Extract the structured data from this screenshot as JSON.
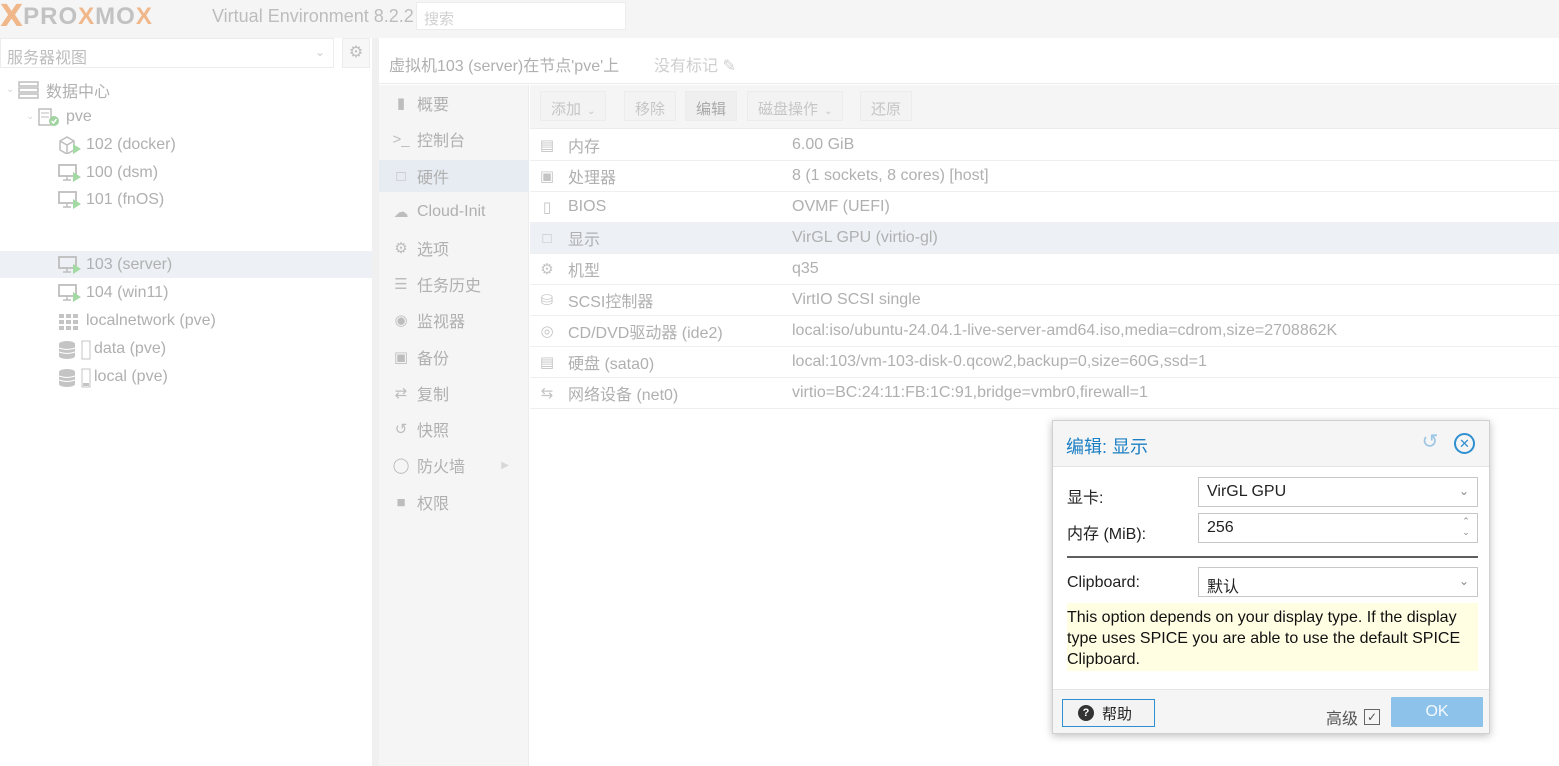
{
  "header": {
    "logo_x1": "X",
    "logo_text1": "PRO",
    "logo_x2": "X",
    "logo_mid": "MO",
    "logo_x3": "X",
    "version": "Virtual Environment 8.2.2",
    "search_placeholder": "搜索"
  },
  "left": {
    "view_selector": "服务器视图",
    "tree": [
      {
        "label": "数据中心",
        "icon": "datacenter-icon"
      },
      {
        "label": "pve",
        "icon": "node-icon"
      },
      {
        "label": "102 (docker)",
        "icon": "container-running-icon"
      },
      {
        "label": "100 (dsm)",
        "icon": "vm-running-icon"
      },
      {
        "label": "101 (fnOS)",
        "icon": "vm-running-icon"
      },
      {
        "label": "103 (server)",
        "icon": "vm-running-icon"
      },
      {
        "label": "104 (win11)",
        "icon": "vm-running-icon"
      },
      {
        "label": "localnetwork (pve)",
        "icon": "sdn-grid-icon"
      },
      {
        "label": "data (pve)",
        "icon": "storage-icon"
      },
      {
        "label": "local (pve)",
        "icon": "storage-icon"
      }
    ]
  },
  "right": {
    "title": "虚拟机103 (server)在节点'pve'上",
    "tags": "没有标记",
    "nav": [
      {
        "label": "概要",
        "icon": "book-icon"
      },
      {
        "label": "控制台",
        "icon": "terminal-icon"
      },
      {
        "label": "硬件",
        "icon": "monitor-icon"
      },
      {
        "label": "Cloud-Init",
        "icon": "cloud-icon"
      },
      {
        "label": "选项",
        "icon": "gear-icon"
      },
      {
        "label": "任务历史",
        "icon": "list-icon"
      },
      {
        "label": "监视器",
        "icon": "eye-icon"
      },
      {
        "label": "备份",
        "icon": "floppy-icon"
      },
      {
        "label": "复制",
        "icon": "retweet-icon"
      },
      {
        "label": "快照",
        "icon": "history-icon"
      },
      {
        "label": "防火墙",
        "icon": "shield-icon"
      },
      {
        "label": "权限",
        "icon": "unlock-icon"
      }
    ],
    "toolbar": {
      "add": "添加",
      "remove": "移除",
      "edit": "编辑",
      "disk_action": "磁盘操作",
      "revert": "还原"
    },
    "hardware": [
      {
        "name": "内存",
        "value": "6.00 GiB",
        "icon": "memory-icon"
      },
      {
        "name": "处理器",
        "value": "8 (1 sockets, 8 cores) [host]",
        "icon": "cpu-icon"
      },
      {
        "name": "BIOS",
        "value": "OVMF (UEFI)",
        "icon": "microchip-icon"
      },
      {
        "name": "显示",
        "value": "VirGL GPU (virtio-gl)",
        "icon": "desktop-icon"
      },
      {
        "name": "机型",
        "value": "q35",
        "icon": "cogs-icon"
      },
      {
        "name": "SCSI控制器",
        "value": "VirtIO SCSI single",
        "icon": "database-icon"
      },
      {
        "name": "CD/DVD驱动器 (ide2)",
        "value": "local:iso/ubuntu-24.04.1-live-server-amd64.iso,media=cdrom,size=2708862K",
        "icon": "cdrom-icon"
      },
      {
        "name": "硬盘 (sata0)",
        "value": "local:103/vm-103-disk-0.qcow2,backup=0,size=60G,ssd=1",
        "icon": "hdd-icon"
      },
      {
        "name": "网络设备 (net0)",
        "value": "virtio=BC:24:11:FB:1C:91,bridge=vmbr0,firewall=1",
        "icon": "exchange-icon"
      }
    ]
  },
  "dialog": {
    "title": "编辑: 显示",
    "gpu_label": "显卡:",
    "gpu_value": "VirGL GPU",
    "mem_label": "内存 (MiB):",
    "mem_value": "256",
    "clipboard_label": "Clipboard:",
    "clipboard_value": "默认",
    "info": "This option depends on your display type. If the display type uses SPICE you are able to use the default SPICE Clipboard.",
    "help": "帮助",
    "advanced": "高级",
    "advanced_checked": true,
    "ok": "OK"
  }
}
